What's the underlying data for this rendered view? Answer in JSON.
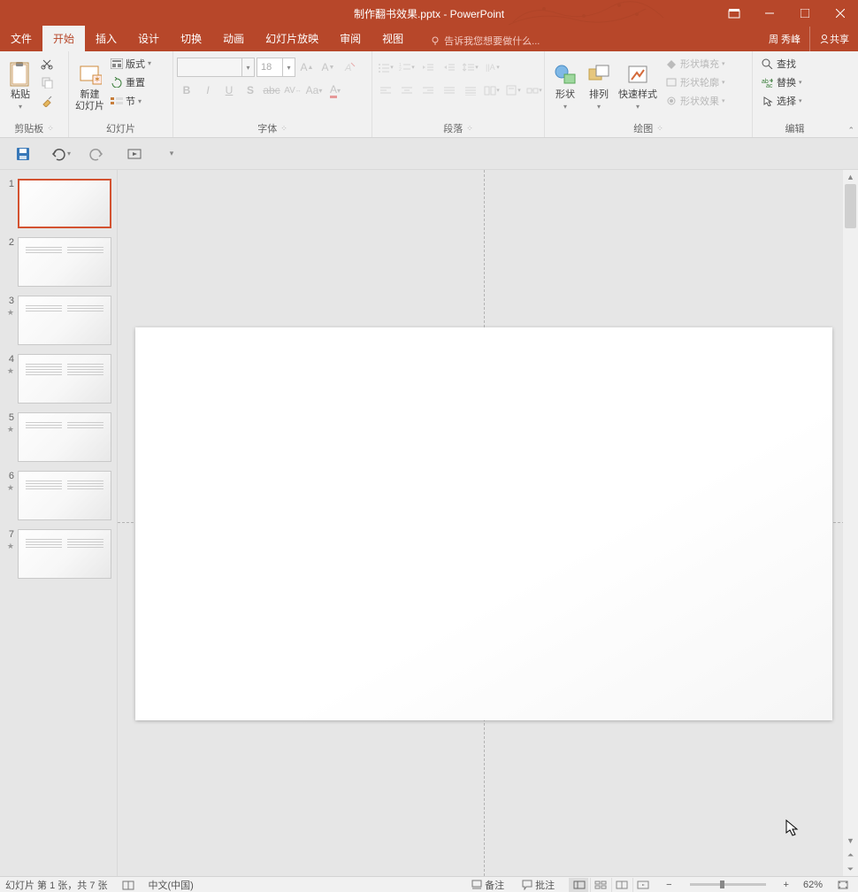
{
  "app": {
    "title": "制作翻书效果.pptx - PowerPoint",
    "user": "周 秀峰",
    "share": "共享"
  },
  "tabs": {
    "file": "文件",
    "home": "开始",
    "insert": "插入",
    "design": "设计",
    "transitions": "切换",
    "anim": "动画",
    "show": "幻灯片放映",
    "review": "审阅",
    "view": "视图",
    "tell": "告诉我您想要做什么..."
  },
  "ribbon": {
    "clipboard": {
      "label": "剪贴板",
      "paste": "粘贴"
    },
    "slides": {
      "label": "幻灯片",
      "new": "新建\n幻灯片",
      "layout": "版式",
      "reset": "重置",
      "section": "节"
    },
    "font": {
      "label": "字体",
      "size": "18"
    },
    "para": {
      "label": "段落"
    },
    "draw": {
      "label": "绘图",
      "shapes": "形状",
      "arrange": "排列",
      "quick": "快速样式",
      "fill": "形状填充",
      "outline": "形状轮廓",
      "effects": "形状效果"
    },
    "edit": {
      "label": "编辑",
      "find": "查找",
      "replace": "替换",
      "select": "选择"
    }
  },
  "thumbs": {
    "count": 7,
    "active": 1,
    "stars": [
      3,
      4,
      5,
      6,
      7
    ]
  },
  "status": {
    "slide": "幻灯片 第 1 张，共 7 张",
    "lang": "中文(中国)",
    "notes": "备注",
    "comments": "批注",
    "zoom": "62%"
  }
}
